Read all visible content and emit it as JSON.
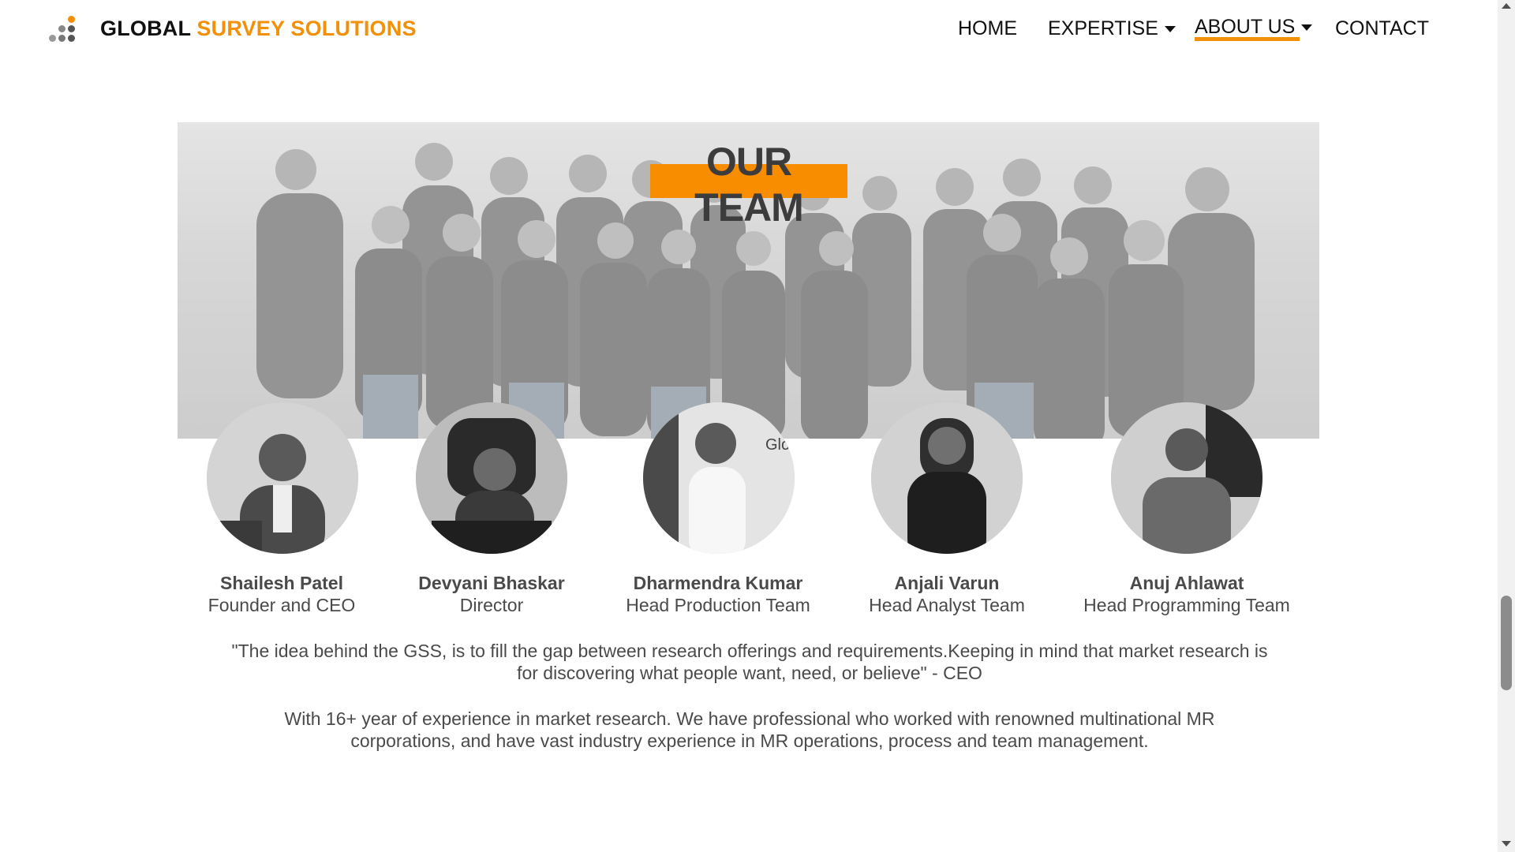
{
  "header": {
    "brand_part1": "GLOBAL",
    "brand_part2": "SURVEY SOLUTIONS",
    "logo_icon": "dots-logo-icon",
    "nav": [
      {
        "label": "HOME",
        "has_dropdown": false,
        "active": false
      },
      {
        "label": "EXPERTISE",
        "has_dropdown": true,
        "active": false
      },
      {
        "label": "ABOUT US",
        "has_dropdown": true,
        "active": true
      },
      {
        "label": "CONTACT",
        "has_dropdown": false,
        "active": false
      }
    ]
  },
  "hero": {
    "title": "OUR TEAM"
  },
  "team": [
    {
      "name": "Shailesh Patel",
      "role": "Founder and CEO"
    },
    {
      "name": "Devyani Bhaskar",
      "role": "Director"
    },
    {
      "name": "Dharmendra Kumar",
      "role": "Head Production Team"
    },
    {
      "name": "Anjali Varun",
      "role": "Head Analyst Team"
    },
    {
      "name": "Anuj Ahlawat",
      "role": "Head Programming Team"
    }
  ],
  "quote": "\"The idea behind the GSS, is to fill the gap between research offerings and requirements.Keeping in mind that market research is for discovering what people want, need, or believe\" - CEO",
  "about": "With 16+ year of experience in market research. We have professional who worked with renowned multinational MR corporations, and have vast industry experience in MR operations, process and team management.",
  "colors": {
    "accent": "#f39009",
    "title_bar": "#f98d00",
    "text": "#4a4a4a"
  }
}
